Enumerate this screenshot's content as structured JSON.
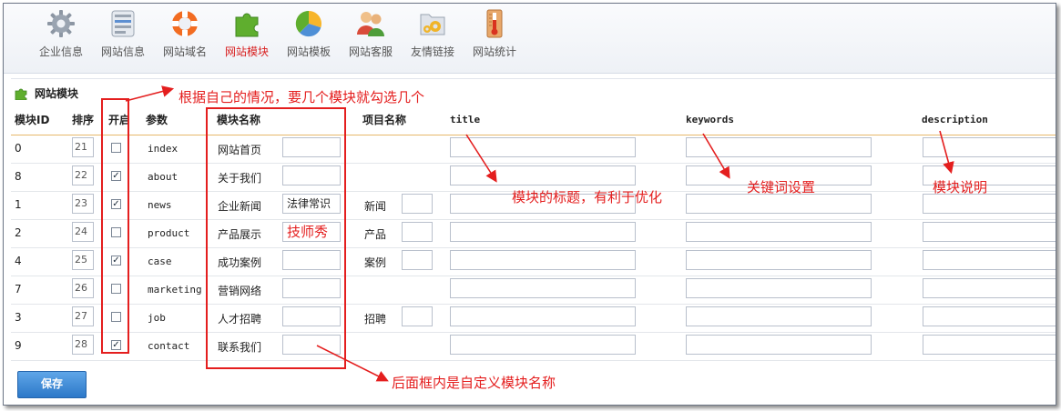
{
  "toolbar": {
    "items": [
      {
        "label": "企业信息",
        "icon": "gear-icon"
      },
      {
        "label": "网站信息",
        "icon": "info-card-icon"
      },
      {
        "label": "网站域名",
        "icon": "lifebuoy-icon"
      },
      {
        "label": "网站模块",
        "icon": "puzzle-icon"
      },
      {
        "label": "网站模板",
        "icon": "pie-chart-icon"
      },
      {
        "label": "网站客服",
        "icon": "users-icon"
      },
      {
        "label": "友情链接",
        "icon": "folder-gears-icon"
      },
      {
        "label": "网站统计",
        "icon": "thermometer-icon"
      }
    ],
    "active_index": 3
  },
  "section": {
    "title": "网站模块",
    "icon": "puzzle-icon"
  },
  "table": {
    "headers": {
      "id": "模块ID",
      "order": "排序",
      "enabled": "开启",
      "param": "参数",
      "module_name": "模块名称",
      "project_name": "项目名称",
      "title": "title",
      "keywords": "keywords",
      "description": "description"
    },
    "rows": [
      {
        "id": "0",
        "order": "21",
        "checked": false,
        "param": "index",
        "name": "网站首页",
        "custom": "",
        "project": "",
        "has_project_input": false
      },
      {
        "id": "8",
        "order": "22",
        "checked": true,
        "param": "about",
        "name": "关于我们",
        "custom": "",
        "project": "",
        "has_project_input": false
      },
      {
        "id": "1",
        "order": "23",
        "checked": true,
        "param": "news",
        "name": "企业新闻",
        "custom": "法律常识",
        "project": "新闻",
        "has_project_input": true
      },
      {
        "id": "2",
        "order": "24",
        "checked": false,
        "param": "product",
        "name": "产品展示",
        "custom": "技师秀",
        "project": "产品",
        "has_project_input": true
      },
      {
        "id": "4",
        "order": "25",
        "checked": true,
        "param": "case",
        "name": "成功案例",
        "custom": "",
        "project": "案例",
        "has_project_input": true
      },
      {
        "id": "7",
        "order": "26",
        "checked": false,
        "param": "marketing",
        "name": "营销网络",
        "custom": "",
        "project": "",
        "has_project_input": false
      },
      {
        "id": "3",
        "order": "27",
        "checked": false,
        "param": "job",
        "name": "人才招聘",
        "custom": "",
        "project": "招聘",
        "has_project_input": true
      },
      {
        "id": "9",
        "order": "28",
        "checked": true,
        "param": "contact",
        "name": "联系我们",
        "custom": "",
        "project": "",
        "has_project_input": false
      }
    ]
  },
  "save_label": "保存",
  "annotations": {
    "checkbox_note": "根据自己的情况，要几个模块就勾选几个",
    "title_note": "模块的标题，有利于优化",
    "keywords_note": "关键词设置",
    "description_note": "模块说明",
    "custom_name_note": "后面框内是自定义模块名称"
  },
  "colors": {
    "annotation_red": "#e41e1e",
    "active_tab_red": "#d81e1e",
    "save_button_blue": "#2c78c8",
    "header_rule_orange": "#e6b86a"
  }
}
